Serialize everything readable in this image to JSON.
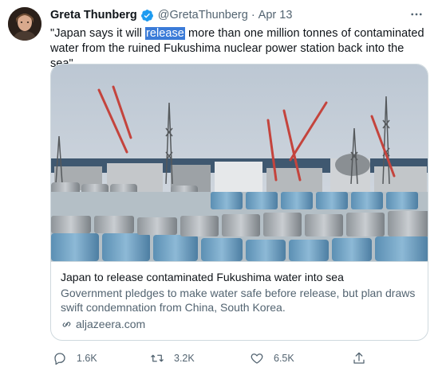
{
  "tweet": {
    "author_name": "Greta Thunberg",
    "handle": "@GretaThunberg",
    "separator": "·",
    "date": "Apr 13",
    "text_before": "\"Japan says it will ",
    "text_highlight": "release",
    "text_after": " more than one million tonnes of contaminated water from the ruined Fukushima nuclear power station back into the sea\""
  },
  "card": {
    "title": "Japan to release contaminated Fukushima water into sea",
    "description": "Government pledges to make water safe before release, but plan draws swift condemnation from China, South Korea.",
    "domain": "aljazeera.com"
  },
  "actions": {
    "replies": "1.6K",
    "retweets": "3.2K",
    "likes": "6.5K"
  },
  "icons": {
    "verified": "verified-badge-icon",
    "more": "more-options-icon",
    "link": "link-icon",
    "reply": "reply-icon",
    "retweet": "retweet-icon",
    "like": "heart-icon",
    "share": "share-icon"
  },
  "colors": {
    "verified_blue": "#1d9bf0",
    "secondary_text": "#536471",
    "highlight": "#3b7bd8"
  }
}
